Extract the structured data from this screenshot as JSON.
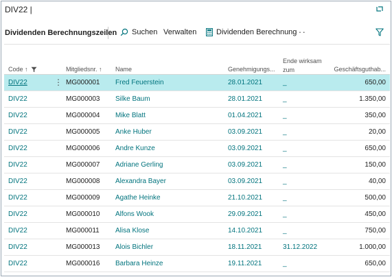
{
  "window": {
    "title": "DIV22 |"
  },
  "toolbar": {
    "page_title": "Dividenden Berechnungszeilen",
    "search_label": "Suchen",
    "manage_label": "Verwalten",
    "action_label": "Dividenden Berechnung",
    "more_label": "···"
  },
  "columns": {
    "code": "Code ↑",
    "mitglied": "Mitgliedsnr. ↑",
    "name": "Name",
    "genehmigung": "Genehmigungs...",
    "ende_line1": "Ende wirksam",
    "ende_line2": "zum",
    "guthaben": "Geschäftsguthab..."
  },
  "rows": [
    {
      "code": "DIV22",
      "mitglied": "MG000001",
      "name": "Fred Feuerstein",
      "genehmigung": "28.01.2021",
      "ende": "_",
      "guthaben": "650,00"
    },
    {
      "code": "DIV22",
      "mitglied": "MG000003",
      "name": "Silke Baum",
      "genehmigung": "28.01.2021",
      "ende": "_",
      "guthaben": "1.350,00"
    },
    {
      "code": "DIV22",
      "mitglied": "MG000004",
      "name": "Mike Blatt",
      "genehmigung": "01.04.2021",
      "ende": "_",
      "guthaben": "350,00"
    },
    {
      "code": "DIV22",
      "mitglied": "MG000005",
      "name": "Anke Huber",
      "genehmigung": "03.09.2021",
      "ende": "_",
      "guthaben": "20,00"
    },
    {
      "code": "DIV22",
      "mitglied": "MG000006",
      "name": "Andre Kunze",
      "genehmigung": "03.09.2021",
      "ende": "_",
      "guthaben": "650,00"
    },
    {
      "code": "DIV22",
      "mitglied": "MG000007",
      "name": "Adriane Gerling",
      "genehmigung": "03.09.2021",
      "ende": "_",
      "guthaben": "150,00"
    },
    {
      "code": "DIV22",
      "mitglied": "MG000008",
      "name": "Alexandra Bayer",
      "genehmigung": "03.09.2021",
      "ende": "_",
      "guthaben": "40,00"
    },
    {
      "code": "DIV22",
      "mitglied": "MG000009",
      "name": "Agathe Heinke",
      "genehmigung": "21.10.2021",
      "ende": "_",
      "guthaben": "500,00"
    },
    {
      "code": "DIV22",
      "mitglied": "MG000010",
      "name": "Alfons Wook",
      "genehmigung": "29.09.2021",
      "ende": "_",
      "guthaben": "450,00"
    },
    {
      "code": "DIV22",
      "mitglied": "MG000011",
      "name": "Alisa Klose",
      "genehmigung": "14.10.2021",
      "ende": "_",
      "guthaben": "750,00"
    },
    {
      "code": "DIV22",
      "mitglied": "MG000013",
      "name": "Alois Bichler",
      "genehmigung": "18.11.2021",
      "ende": "31.12.2022",
      "guthaben": "1.000,00"
    },
    {
      "code": "DIV22",
      "mitglied": "MG000016",
      "name": "Barbara Heinze",
      "genehmigung": "19.11.2021",
      "ende": "_",
      "guthaben": "650,00"
    }
  ],
  "selected_row_index": 0,
  "row_menu_label": "⋮",
  "colors": {
    "accent": "#00737d",
    "selected_row": "#b9ebee"
  }
}
